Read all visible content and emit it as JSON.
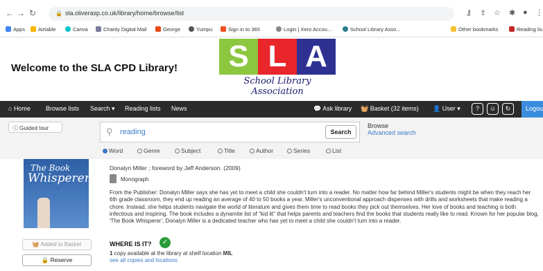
{
  "browser": {
    "url": "sla.oliverasp.co.uk/library/home/browse/list",
    "bookmarks": [
      "Apps",
      "Airtable",
      "Canva",
      "Charity Digital Mail",
      "George",
      "Yumpu",
      "Sign in to 365",
      "Login | Xero Accou...",
      "School Library Asso...",
      "Other bookmarks",
      "Reading lis"
    ]
  },
  "header": {
    "welcome": "Welcome to the SLA CPD Library!",
    "logo_letters": [
      "S",
      "L",
      "A"
    ],
    "logo_colors": [
      "#8dc63f",
      "#e8262c",
      "#2e3192"
    ],
    "logo_sub": "School Library Association"
  },
  "nav": {
    "home": "Home",
    "browse_lists": "Browse lists",
    "search": "Search",
    "reading_lists": "Reading lists",
    "news": "News",
    "ask_library": "Ask library",
    "basket": "Basket (32 items)",
    "user": "User",
    "logout": "Logout"
  },
  "search": {
    "guided_tour": "Guided tour",
    "query": "reading",
    "button": "Search",
    "browse": "Browse",
    "advanced": "Advanced search",
    "options": [
      "Word",
      "Genre",
      "Subject",
      "Title",
      "Author",
      "Series",
      "List"
    ],
    "selected": "Word"
  },
  "result": {
    "cover_line1": "The Book",
    "cover_line2": "Whisperer",
    "author_line": "Donalyn Miller ; foreword by Jeff Anderson. (2009)",
    "format": "Monograph",
    "description": "From the Publisher: Donalyn Miller says she has yet to meet a child she couldn't turn into a reader. No matter how far behind Miller's students might be when they reach her 6th grade classroom, they end up reading an average of 40 to 50 books a year. Miller's unconventional approach dispenses with drills and worksheets that make reading a chore. Instead, she helps students navigate the world of literature and gives them time to read books they pick out themselves. Her love of books and teaching is both infectious and inspiring. The book includes a dynamite list of \"kid lit\" that helps parents and teachers find the books that students really like to read. Known for her popular blog, 'The Book Whisperer', Donalyn Miller is a dedicated teacher who has yet to meet a child she couldn't turn into a reader.",
    "added_to_basket": "Added to Basket",
    "reserve": "Reserve",
    "where_is_it": "WHERE IS IT?",
    "copies_count": "1",
    "copies_text": " copy available at the library at shelf location ",
    "shelf": "MIL",
    "see_all": "see all copies and locations"
  }
}
